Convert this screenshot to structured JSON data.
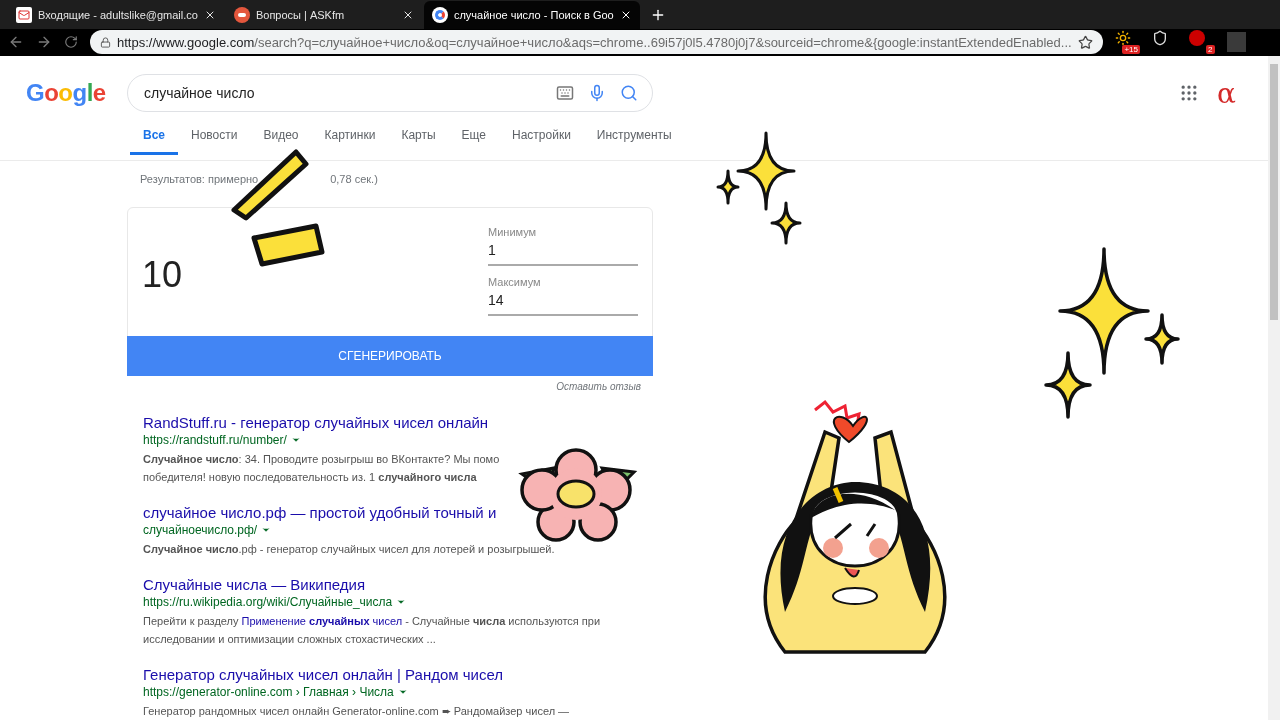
{
  "browser": {
    "tabs": [
      {
        "title": "Входящие - adultslike@gmail.co",
        "kind": "mail",
        "selected": false
      },
      {
        "title": "Вопросы | ASKfm",
        "kind": "ask",
        "selected": false
      },
      {
        "title": "случайное число - Поиск в Goo",
        "kind": "google",
        "selected": true
      }
    ],
    "url": {
      "host": "https://www.google.com",
      "rest": "/search?q=случайное+число&oq=случайное+число&aqs=chrome..69i57j0l5.4780j0j7&sourceid=chrome&{google:instantExtendedEnabled..."
    },
    "extensions": [
      {
        "kind": "weather",
        "badge": "+15"
      },
      {
        "kind": "shield"
      },
      {
        "kind": "adblock",
        "badge": "2"
      }
    ]
  },
  "header": {
    "logo": "Google",
    "query": "случайное число",
    "account_glyph": "α"
  },
  "nav": [
    {
      "label": "Все",
      "selected": true
    },
    {
      "label": "Новости",
      "selected": false
    },
    {
      "label": "Видео",
      "selected": false
    },
    {
      "label": "Картинки",
      "selected": false
    },
    {
      "label": "Карты",
      "selected": false
    },
    {
      "label": "Еще",
      "selected": false
    },
    {
      "label": "Настройки",
      "selected": false
    },
    {
      "label": "Инструменты",
      "selected": false
    }
  ],
  "stats": {
    "before": "Результатов: примерно",
    "after": "0,78 сек.)"
  },
  "generator": {
    "result": "10",
    "min_label": "Минимум",
    "min_value": "1",
    "max_label": "Максимум",
    "max_value": "14",
    "button": "СГЕНЕРИРОВАТЬ",
    "feedback": "Оставить отзыв"
  },
  "results": [
    {
      "title": "RandStuff.ru - генератор случайных чисел онлайн",
      "url": "https://randstuff.ru/number/",
      "snippet": [
        [
          {
            "kind": "text",
            "text": "**Случайное число**: 34. Проводите розыгрыш во ВКонтакте? Мы помо"
          }
        ],
        [
          {
            "kind": "text",
            "text": "победителя! новую последовательность из. 1 **случайного числа**"
          }
        ]
      ]
    },
    {
      "title": "случайное число.рф — простой удобный точный и",
      "url": "случайноечисло.рф/",
      "snippet": [
        [
          {
            "kind": "text",
            "text": "**Случайное число**.рф - генератор случайных чисел для лотерей и розыгрышей."
          }
        ]
      ]
    },
    {
      "title": "Случайные числа — Википедия",
      "url": "https://ru.wikipedia.org/wiki/Случайные_числа",
      "snippet": [
        [
          {
            "kind": "text",
            "text": "Перейти к разделу "
          },
          {
            "kind": "link",
            "text": "Применение **случайных** чисел"
          },
          {
            "kind": "text",
            "text": " - Случайные **числа** используются при"
          }
        ],
        [
          {
            "kind": "text",
            "text": "исследовании и оптимизации сложных стохастических ..."
          }
        ]
      ]
    },
    {
      "title": "Генератор случайных чисел онлайн | Рандом чисел",
      "url": "https://generator-online.com › Главная › Числа",
      "snippet": [
        [
          {
            "kind": "text",
            "text": "Генератор рандомных чисел онлайн Generator-online.com ➨ Рандомайзер чисел —"
          }
        ]
      ]
    }
  ]
}
